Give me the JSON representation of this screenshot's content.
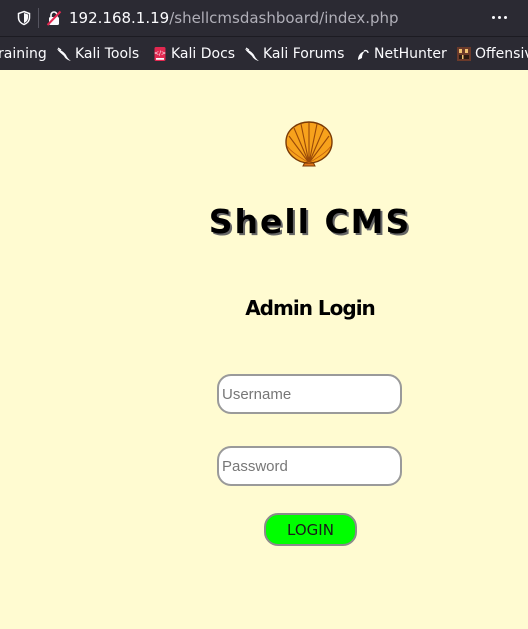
{
  "browser": {
    "url_host": "192.168.1.19",
    "url_path": "/shellcmsdashboard/index.php"
  },
  "bookmarks": [
    {
      "label": "raining",
      "icon": "none"
    },
    {
      "label": "Kali Tools",
      "icon": "kali-dragon-icon"
    },
    {
      "label": "Kali Docs",
      "icon": "kali-docs-icon"
    },
    {
      "label": "Kali Forums",
      "icon": "kali-dragon-icon"
    },
    {
      "label": "NetHunter",
      "icon": "nethunter-icon"
    },
    {
      "label": "Offensiv",
      "icon": "offensive-security-icon"
    }
  ],
  "page": {
    "title": "Shell CMS",
    "subtitle": "Admin Login",
    "username_placeholder": "Username",
    "password_placeholder": "Password",
    "login_label": "LOGIN"
  },
  "colors": {
    "background": "#fffbd1",
    "button": "#00ff00",
    "chrome": "#2b2a33"
  }
}
